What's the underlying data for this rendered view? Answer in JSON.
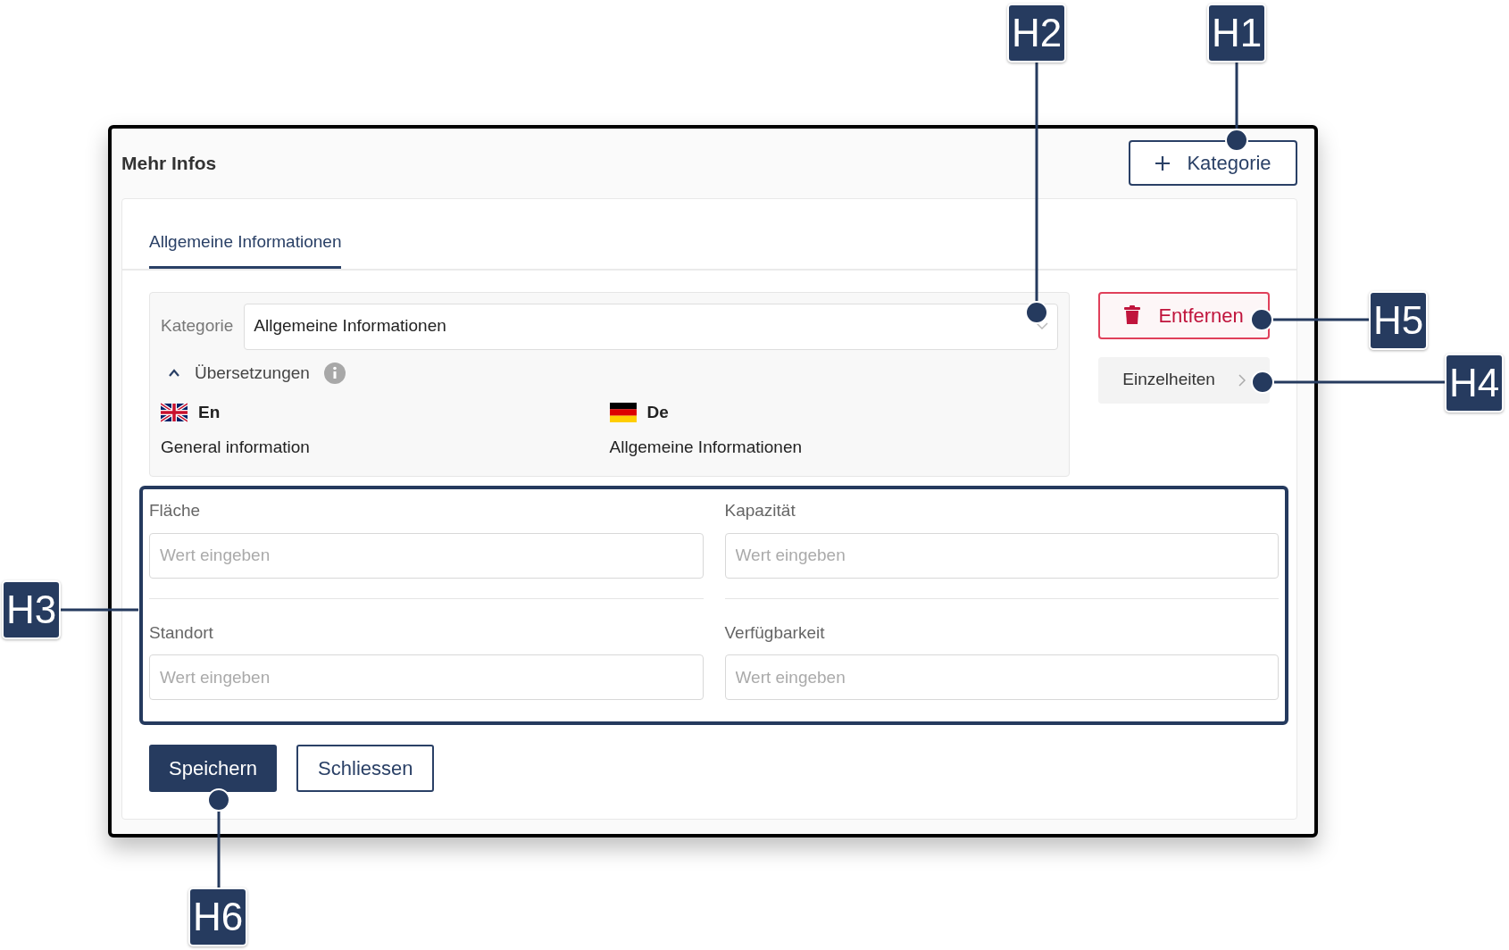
{
  "panel": {
    "title": "Mehr Infos",
    "add_button": "Kategorie"
  },
  "tabs": [
    {
      "label": "Allgemeine Informationen",
      "selected": true
    }
  ],
  "category": {
    "label": "Kategorie",
    "value": "Allgemeine Informationen"
  },
  "translations": {
    "label": "Übersetzungen",
    "expanded": true,
    "languages": [
      {
        "code": "En",
        "kind": "uk",
        "text": "General information"
      },
      {
        "code": "De",
        "kind": "de",
        "text": "Allgemeine Informationen"
      }
    ]
  },
  "remove_button": "Entfernen",
  "details_button": "Einzelheiten",
  "fields": [
    {
      "label": "Fläche",
      "placeholder": "Wert eingeben"
    },
    {
      "label": "Kapazität",
      "placeholder": "Wert eingeben"
    },
    {
      "label": "Standort",
      "placeholder": "Wert eingeben"
    },
    {
      "label": "Verfügbarkeit",
      "placeholder": "Wert eingeben"
    }
  ],
  "actions": [
    {
      "label": "Speichern",
      "kind": "primary"
    },
    {
      "label": "Schliessen",
      "kind": "secondary"
    }
  ],
  "callouts": [
    "H1",
    "H2",
    "H3",
    "H4",
    "H5",
    "H6"
  ]
}
